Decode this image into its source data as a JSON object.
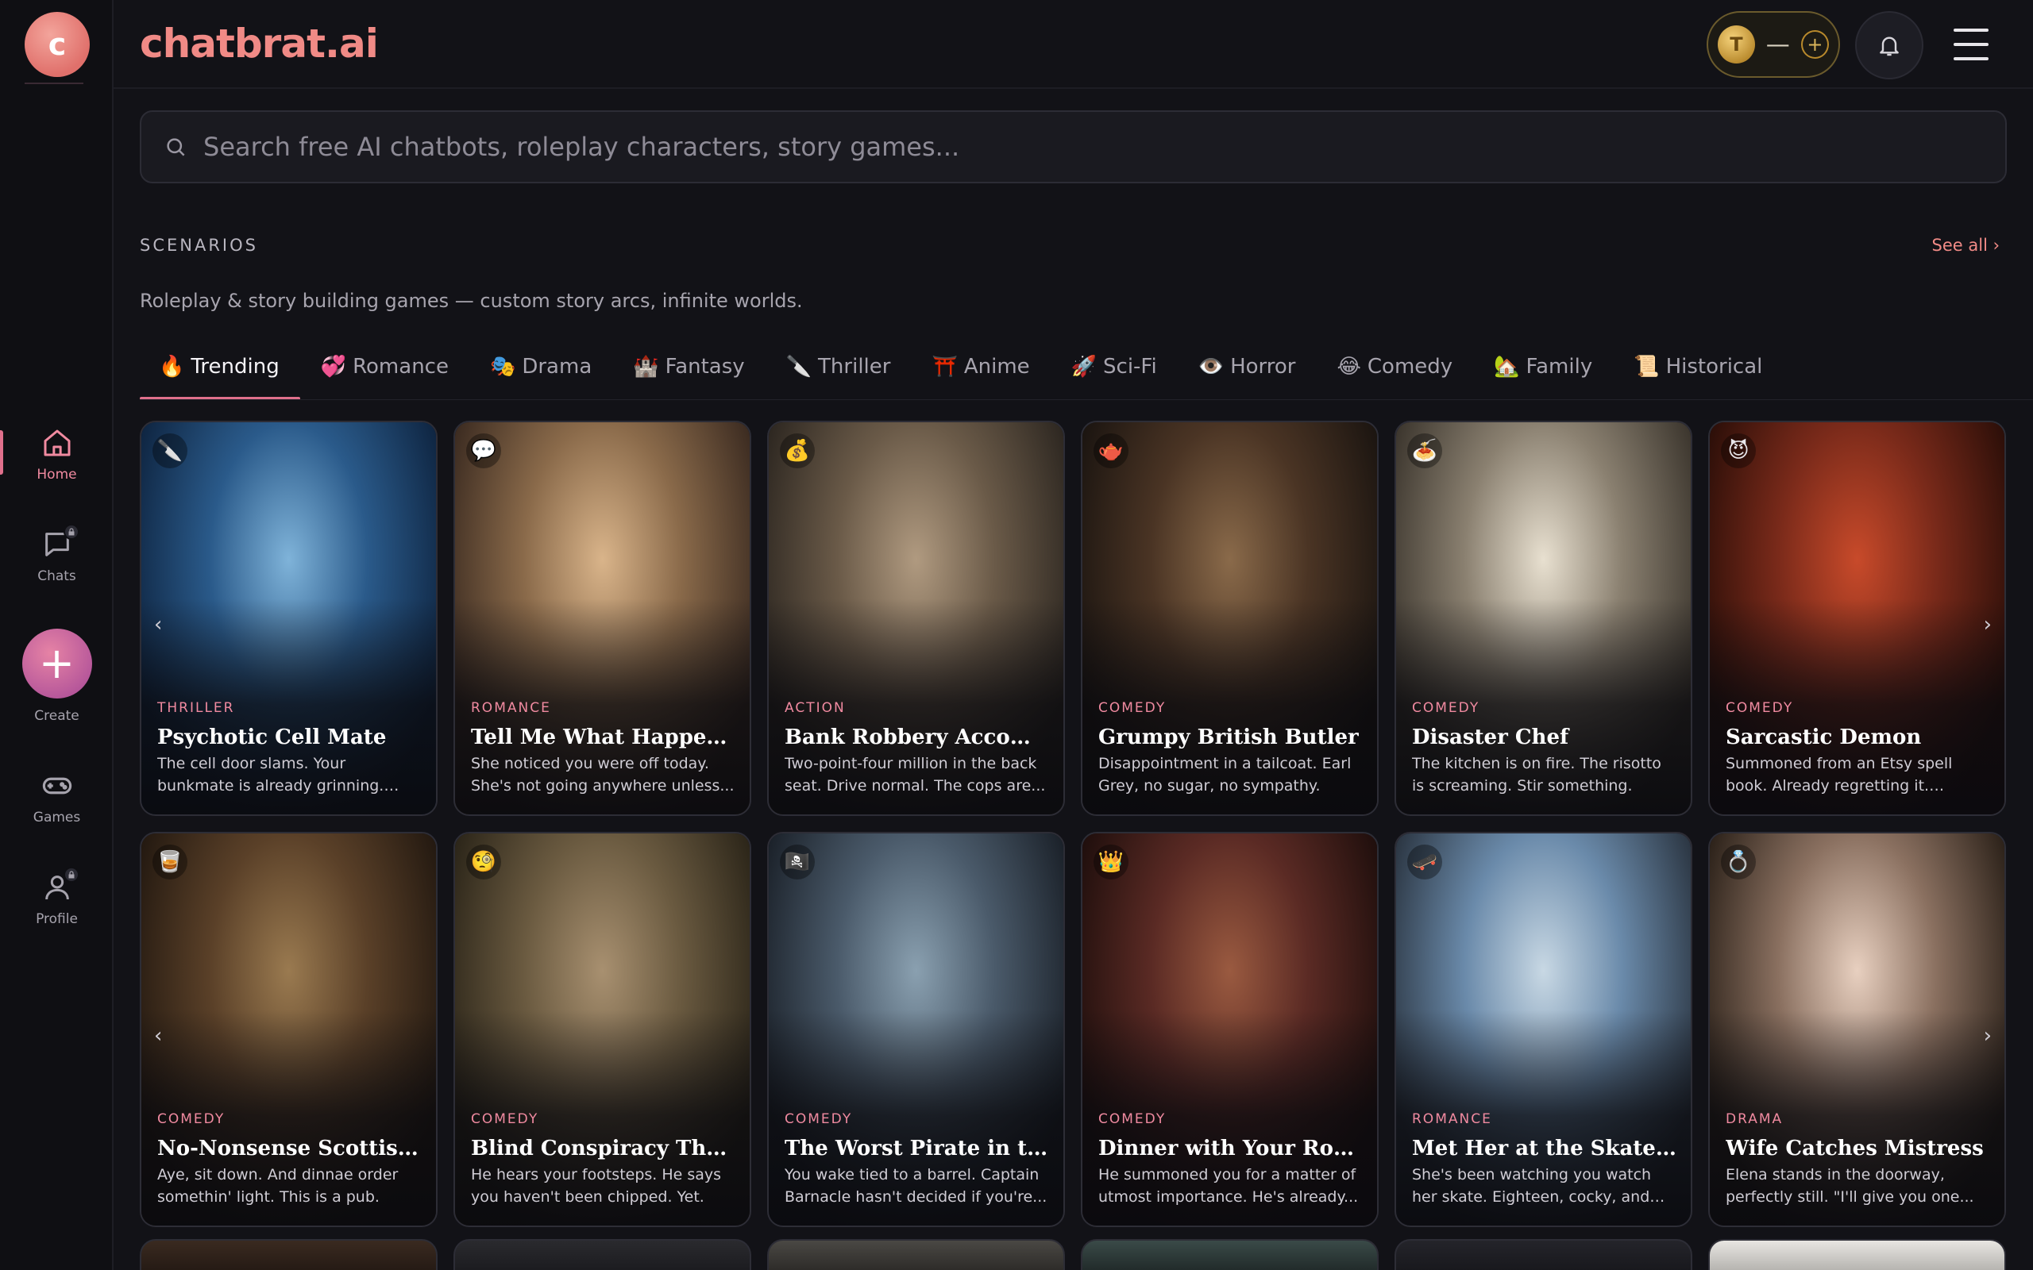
{
  "app": {
    "brand": "chatbrat.ai",
    "logo_letter": "c"
  },
  "sidebar": {
    "items": [
      {
        "label": "Home",
        "icon": "home-icon",
        "active": true
      },
      {
        "label": "Chats",
        "icon": "chat-icon",
        "locked": true
      },
      {
        "label": "Create",
        "icon": "plus-icon"
      },
      {
        "label": "Games",
        "icon": "gamepad-icon"
      },
      {
        "label": "Profile",
        "icon": "user-icon",
        "locked": true
      }
    ]
  },
  "header": {
    "coin_symbol": "T",
    "coin_balance": "—",
    "coin_plus": "+"
  },
  "search": {
    "placeholder": "Search free AI chatbots, roleplay characters, story games..."
  },
  "section": {
    "title": "SCENARIOS",
    "see_all": "See all ›",
    "subtitle": "Roleplay & story building games — custom story arcs, infinite worlds."
  },
  "tabs": [
    {
      "emoji": "🔥",
      "label": "Trending",
      "active": true
    },
    {
      "emoji": "💞",
      "label": "Romance"
    },
    {
      "emoji": "🎭",
      "label": "Drama"
    },
    {
      "emoji": "🏰",
      "label": "Fantasy"
    },
    {
      "emoji": "🔪",
      "label": "Thriller"
    },
    {
      "emoji": "⛩️",
      "label": "Anime"
    },
    {
      "emoji": "🚀",
      "label": "Sci-Fi"
    },
    {
      "emoji": "👁️",
      "label": "Horror"
    },
    {
      "emoji": "😂",
      "label": "Comedy"
    },
    {
      "emoji": "🏡",
      "label": "Family"
    },
    {
      "emoji": "📜",
      "label": "Historical"
    }
  ],
  "nav_arrows": {
    "prev": "‹",
    "next": "›"
  },
  "cards": [
    {
      "badge": "🔪",
      "genre": "THRILLER",
      "title": "Psychotic Cell Mate",
      "desc": "The cell door slams. Your bunkmate is already grinning. Most scream...",
      "colors": [
        "#2a5a8a",
        "#0e2440",
        "#7fb3d9"
      ]
    },
    {
      "badge": "💬",
      "genre": "ROMANCE",
      "title": "Tell Me What Happened",
      "desc": "She noticed you were off today. She's not going anywhere unless...",
      "colors": [
        "#8a6a4a",
        "#3a2a20",
        "#d9b48a"
      ]
    },
    {
      "badge": "💰",
      "genre": "ACTION",
      "title": "Bank Robbery Accomplice",
      "desc": "Two-point-four million in the back seat. Drive normal. The cops are...",
      "colors": [
        "#6a5a48",
        "#2c2620",
        "#b09a80"
      ]
    },
    {
      "badge": "🫖",
      "genre": "COMEDY",
      "title": "Grumpy British Butler",
      "desc": "Disappointment in a tailcoat. Earl Grey, no sugar, no sympathy.",
      "colors": [
        "#4a3424",
        "#1a1410",
        "#8a6a4a"
      ]
    },
    {
      "badge": "🍝",
      "genre": "COMEDY",
      "title": "Disaster Chef",
      "desc": "The kitchen is on fire. The risotto is screaming. Stir something.",
      "colors": [
        "#8a8070",
        "#3a342c",
        "#e8e0d0"
      ]
    },
    {
      "badge": "😈",
      "genre": "COMEDY",
      "title": "Sarcastic Demon",
      "desc": "Summoned from an Etsy spell book. Already regretting it. Charge...",
      "colors": [
        "#7a2a1a",
        "#2a0e08",
        "#c84a2a"
      ]
    },
    {
      "badge": "🥃",
      "genre": "COMEDY",
      "title": "No-Nonsense Scottish Pub Landlord",
      "desc": "Aye, sit down. And dinnae order somethin' light. This is a pub.",
      "colors": [
        "#5a4028",
        "#221810",
        "#9a7a50"
      ]
    },
    {
      "badge": "🧐",
      "genre": "COMEDY",
      "title": "Blind Conspiracy Theorist",
      "desc": "He hears your footsteps. He says you haven't been chipped. Yet.",
      "colors": [
        "#6a5a40",
        "#2a2418",
        "#a89070"
      ]
    },
    {
      "badge": "🏴‍☠️",
      "genre": "COMEDY",
      "title": "The Worst Pirate in the Caribbean",
      "desc": "You wake tied to a barrel. Captain Barnacle hasn't decided if you're...",
      "colors": [
        "#4a5a6a",
        "#1a2028",
        "#8aa0b0"
      ]
    },
    {
      "badge": "👑",
      "genre": "COMEDY",
      "title": "Dinner with Your Royal Highness",
      "desc": "He summoned you for a matter of utmost importance. He's already...",
      "colors": [
        "#5a2a24",
        "#1e0e0c",
        "#9a5a40"
      ]
    },
    {
      "badge": "🛹",
      "genre": "ROMANCE",
      "title": "Met Her at the Skatepark",
      "desc": "She's been watching you watch her skate. Eighteen, cocky, and staying...",
      "colors": [
        "#6a8aaa",
        "#2a3440",
        "#c8d8e4"
      ]
    },
    {
      "badge": "💍",
      "genre": "DRAMA",
      "title": "Wife Catches Mistress",
      "desc": "Elena stands in the doorway, perfectly still. \"I'll give you one...",
      "colors": [
        "#8a7060",
        "#2a2018",
        "#e8d0c0"
      ]
    }
  ],
  "peek": [
    {
      "colors": [
        "#3a2a20",
        "#1a120e"
      ]
    },
    {
      "colors": [
        "#2a2a2e",
        "#141418"
      ]
    },
    {
      "colors": [
        "#4a4844",
        "#1e1c1a"
      ]
    },
    {
      "colors": [
        "#3a4a48",
        "#141a1a"
      ]
    },
    {
      "colors": [
        "#24242a",
        "#121216"
      ]
    },
    {
      "colors": [
        "#e8e6e2",
        "#9a9894"
      ]
    }
  ]
}
